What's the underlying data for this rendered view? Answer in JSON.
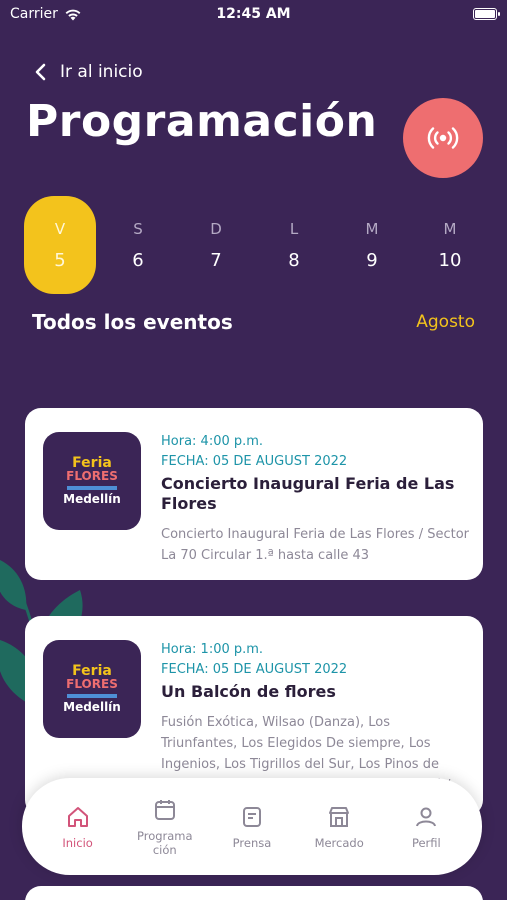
{
  "status": {
    "carrier": "Carrier",
    "time": "12:45 AM"
  },
  "nav": {
    "back_label": "Ir al inicio"
  },
  "page": {
    "title": "Programación"
  },
  "days": [
    {
      "dow": "V",
      "num": "5",
      "active": true
    },
    {
      "dow": "S",
      "num": "6"
    },
    {
      "dow": "D",
      "num": "7"
    },
    {
      "dow": "L",
      "num": "8"
    },
    {
      "dow": "M",
      "num": "9"
    },
    {
      "dow": "M",
      "num": "10"
    }
  ],
  "section": {
    "title": "Todos los eventos",
    "month": "Agosto"
  },
  "events": [
    {
      "hora": "Hora: 4:00 p.m.",
      "fecha": "FECHA: 05 DE AUGUST 2022",
      "title": "Concierto Inaugural Feria de Las Flores",
      "desc": "Concierto Inaugural Feria de Las Flores / Sector La 70 Circular 1.ª hasta calle 43",
      "thumb": {
        "line1": "Feria",
        "line2": "FLORES",
        "line3": "Medellín"
      }
    },
    {
      "hora": "Hora: 1:00 p.m.",
      "fecha": "FECHA: 05 DE AUGUST 2022",
      "title": "Un Balcón de flores",
      "desc": "Fusión Exótica, Wilsao (Danza), Los Triunfantes, Los Elegidos De siempre, Los Ingenios, Los Tigrillos del Sur, Los Pinos de Colombia, Los Geniales, Los Hijos de Urabá /",
      "thumb": {
        "line1": "Feria",
        "line2": "FLORES",
        "line3": "Medellín"
      }
    }
  ],
  "tabs": [
    {
      "label": "Inicio",
      "icon": "home-icon",
      "active": true
    },
    {
      "label": "Programa ción",
      "icon": "calendar-icon"
    },
    {
      "label": "Prensa",
      "icon": "document-icon"
    },
    {
      "label": "Mercado",
      "icon": "store-icon"
    },
    {
      "label": "Perfil",
      "icon": "user-icon"
    }
  ],
  "colors": {
    "background": "#3b2556",
    "accent": "#f3c31c",
    "live": "#ee6e70",
    "teal": "#1d94a8",
    "active_tab": "#d2547a"
  }
}
